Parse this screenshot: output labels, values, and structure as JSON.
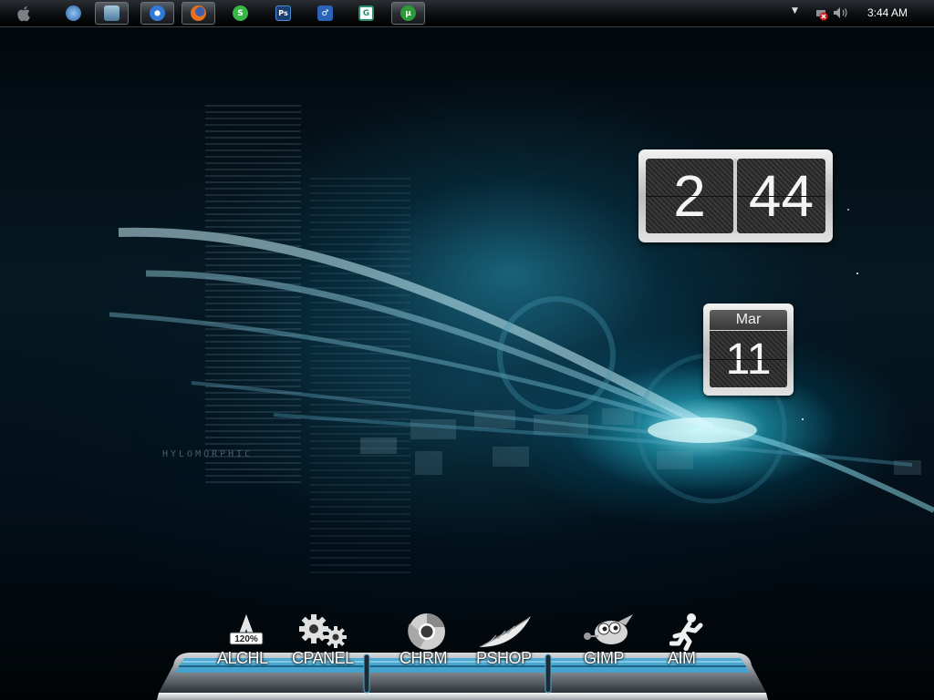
{
  "taskbar": {
    "start": {
      "icon": "apple-icon"
    },
    "buttons": [
      {
        "name": "quicklaunch-browser",
        "icon": "globe-icon",
        "color": "#3a7fd0",
        "active": false
      },
      {
        "name": "quicklaunch-explorer",
        "icon": "folder-icon",
        "color": "#5b8fb0",
        "active": true
      },
      {
        "name": "chrome",
        "icon": "chrome-icon",
        "color": "#2f7ad6",
        "active": true
      },
      {
        "name": "firefox",
        "icon": "firefox-icon",
        "color": "#e8701a",
        "active": true
      },
      {
        "name": "app-s",
        "icon": "s-icon",
        "color": "#39b54a",
        "active": false
      },
      {
        "name": "photoshop",
        "icon": "photoshop-icon",
        "color": "#1b4f8c",
        "active": false,
        "text": "Ps"
      },
      {
        "name": "app-runner",
        "icon": "runner-icon",
        "color": "#2b63b8",
        "active": false
      },
      {
        "name": "app-g",
        "icon": "g-icon",
        "color": "#2a8f6a",
        "active": false
      },
      {
        "name": "utorrent",
        "icon": "utorrent-icon",
        "color": "#2e9a3a",
        "active": true
      }
    ],
    "tray": {
      "time": "3:44 AM",
      "network_icon": "network-error-icon",
      "volume_icon": "volume-icon",
      "arrow_icon": "tray-arrow-icon"
    }
  },
  "widgets": {
    "flip_clock": {
      "hour": "2",
      "minute": "44"
    },
    "calendar": {
      "month": "Mar",
      "day": "11"
    }
  },
  "dock": {
    "items": [
      {
        "label": "ALCHL",
        "icon": "alcohol-icon",
        "badge": "120%"
      },
      {
        "label": "CPANEL",
        "icon": "gears-icon"
      },
      {
        "label": "CHRM",
        "icon": "chrome-icon"
      },
      {
        "label": "PSHOP",
        "icon": "feather-icon"
      },
      {
        "label": "GIMP",
        "icon": "gimp-icon"
      },
      {
        "label": "AIM",
        "icon": "aim-runner-icon"
      }
    ]
  },
  "wallpaper": {
    "text": "HYLOMORPHIC"
  }
}
